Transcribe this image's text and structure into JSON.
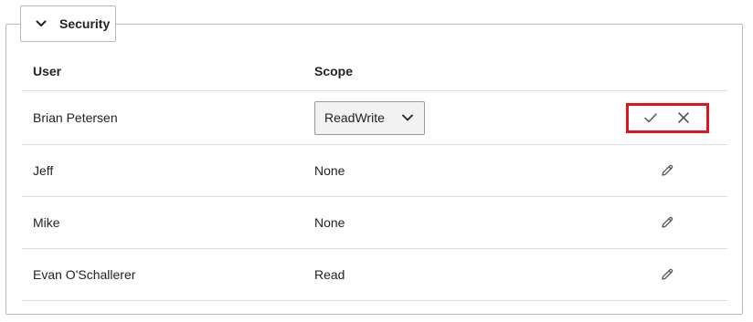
{
  "section": {
    "title": "Security",
    "toggle_icon": "chevron-down-icon"
  },
  "table": {
    "columns": {
      "user": "User",
      "scope": "Scope"
    },
    "rows": [
      {
        "user": "Brian Petersen",
        "scope": "ReadWrite",
        "mode": "editing",
        "actions": [
          "confirm-icon",
          "cancel-icon"
        ]
      },
      {
        "user": "Jeff",
        "scope": "None",
        "mode": "view",
        "actions": [
          "edit-icon"
        ]
      },
      {
        "user": "Mike",
        "scope": "None",
        "mode": "view",
        "actions": [
          "edit-icon"
        ]
      },
      {
        "user": "Evan O'Schallerer",
        "scope": "Read",
        "mode": "view",
        "actions": [
          "edit-icon"
        ]
      }
    ]
  },
  "colors": {
    "highlight": "#e0141f",
    "border": "#b9b9b9",
    "row_divider": "#dcdcdc",
    "icon": "#555555"
  }
}
